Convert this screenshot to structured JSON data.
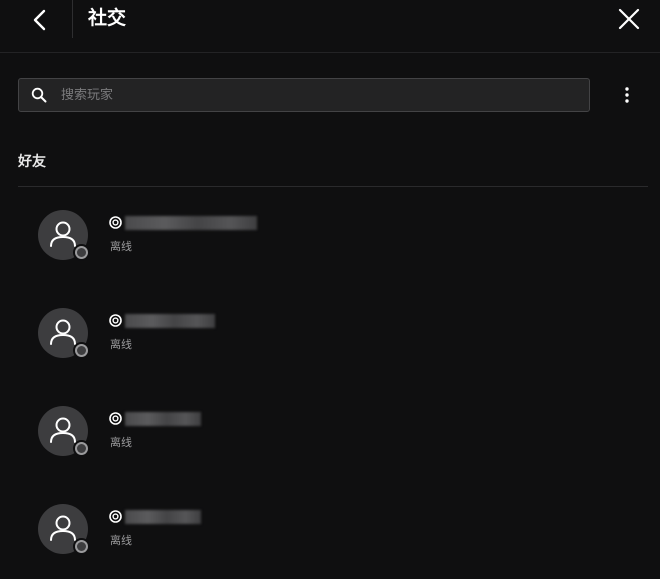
{
  "header": {
    "title": "社交"
  },
  "search": {
    "placeholder": "搜索玩家",
    "value": ""
  },
  "section": {
    "title": "好友"
  },
  "friends": [
    {
      "status": "离线"
    },
    {
      "status": "离线"
    },
    {
      "status": "离线"
    },
    {
      "status": "离线"
    }
  ],
  "colors": {
    "background": "#0f0f10",
    "avatar": "#3d3d3f",
    "status_offline": "#9a9a9c"
  }
}
